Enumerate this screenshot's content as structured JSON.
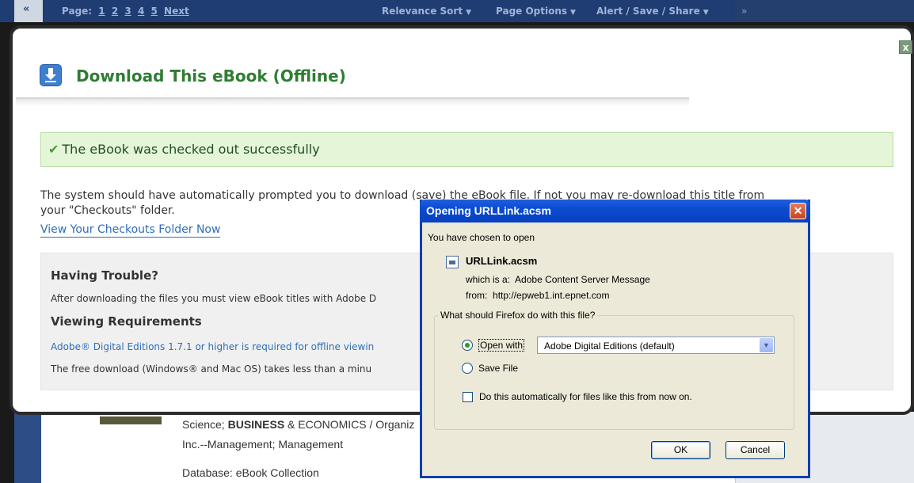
{
  "topbar": {
    "prev": "«",
    "page_label": "Page:",
    "pages": [
      "1",
      "2",
      "3",
      "4",
      "5"
    ],
    "next": "Next",
    "menus": [
      "Relevance Sort",
      "Page Options",
      "Alert / Save / Share"
    ],
    "right_arrow": "»"
  },
  "modal": {
    "close_label": "x",
    "title": "Download This eBook (Offline)",
    "success": "The eBook was checked out successfully",
    "para_line1": "The system should have automatically prompted you to download (save) the eBook file. If not you may re-download this title from",
    "para_line2": "your \"Checkouts\" folder.",
    "checkouts_link": "View Your Checkouts Folder Now",
    "trouble": {
      "heading": "Having Trouble?",
      "text": "After downloading the files you must view eBook titles with Adobe D",
      "req_heading": "Viewing Requirements",
      "req_link": "Adobe® Digital Editions 1.7.1 or higher is required for offline viewin",
      "free_text": "The free download (Windows® and Mac OS) takes less than a minu"
    }
  },
  "under": {
    "line1_prefix": "Science; ",
    "line1_bold": "BUSINESS",
    "line1_rest": " & ECONOMICS / Organiz",
    "line2": "Inc.--Management; Management",
    "line3": "Database: eBook Collection"
  },
  "dialog": {
    "title": "Opening URLLink.acsm",
    "intro": "You have chosen to open",
    "file_name": "URLLink.acsm",
    "which_is_label": "which is a:",
    "which_is_value": "Adobe Content Server Message",
    "from_label": "from:",
    "from_value": "http://epweb1.int.epnet.com",
    "question": "What should Firefox do with this file?",
    "open_with": "Open with",
    "open_with_app": "Adobe Digital Editions (default)",
    "save_file": "Save File",
    "auto_checkbox": "Do this automatically for files like this from now on.",
    "ok": "OK",
    "cancel": "Cancel"
  }
}
